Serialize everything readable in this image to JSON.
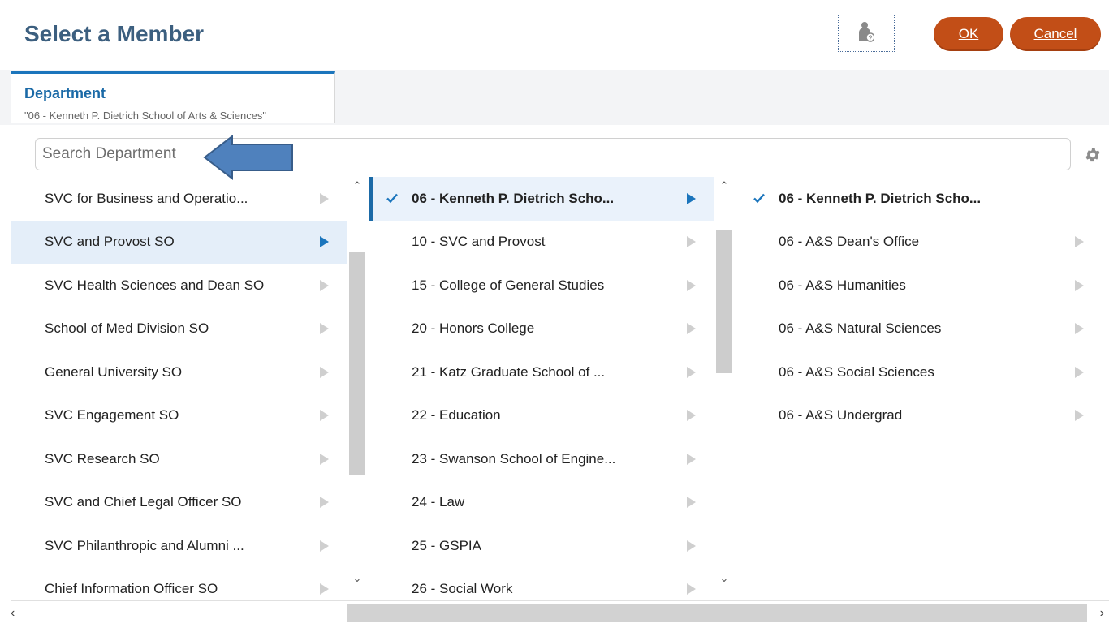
{
  "header": {
    "title": "Select a Member",
    "ok_label": "OK",
    "cancel_label": "Cancel",
    "help_icon": "user-help-icon"
  },
  "tab": {
    "title": "Department",
    "subtitle": "\"06 - Kenneth P. Dietrich School of Arts & Sciences\""
  },
  "search": {
    "placeholder": "Search Department"
  },
  "column1": {
    "items": [
      {
        "label": "SVC for Business and Operatio..."
      },
      {
        "label": "SVC and Provost SO",
        "selected": true
      },
      {
        "label": "SVC Health Sciences and Dean SO"
      },
      {
        "label": "School of Med Division SO"
      },
      {
        "label": "General University SO"
      },
      {
        "label": "SVC Engagement SO"
      },
      {
        "label": "SVC Research SO"
      },
      {
        "label": "SVC and Chief Legal Officer SO"
      },
      {
        "label": "SVC Philanthropic and Alumni ..."
      },
      {
        "label": "Chief Information Officer SO"
      }
    ]
  },
  "column2": {
    "items": [
      {
        "label": "06 - Kenneth P. Dietrich Scho...",
        "checked": true
      },
      {
        "label": "10 - SVC and Provost"
      },
      {
        "label": "15 - College of General Studies"
      },
      {
        "label": "20 - Honors College"
      },
      {
        "label": "21 - Katz Graduate School of ..."
      },
      {
        "label": "22 - Education"
      },
      {
        "label": "23 - Swanson School of Engine..."
      },
      {
        "label": "24 - Law"
      },
      {
        "label": "25 - GSPIA"
      },
      {
        "label": "26 - Social Work"
      }
    ]
  },
  "column3": {
    "items": [
      {
        "label": "06 - Kenneth P. Dietrich Scho...",
        "checked": true
      },
      {
        "label": "06 - A&S Dean's Office"
      },
      {
        "label": "06 - A&S Humanities"
      },
      {
        "label": "06 - A&S Natural Sciences"
      },
      {
        "label": "06 - A&S Social Sciences"
      },
      {
        "label": "06 - A&S Undergrad"
      }
    ]
  },
  "colors": {
    "title": "#3c5f7f",
    "button": "#c24e17",
    "accent": "#1b75bc",
    "selected_row": "#e4eef9",
    "callout_arrow": "#4f81bd"
  }
}
